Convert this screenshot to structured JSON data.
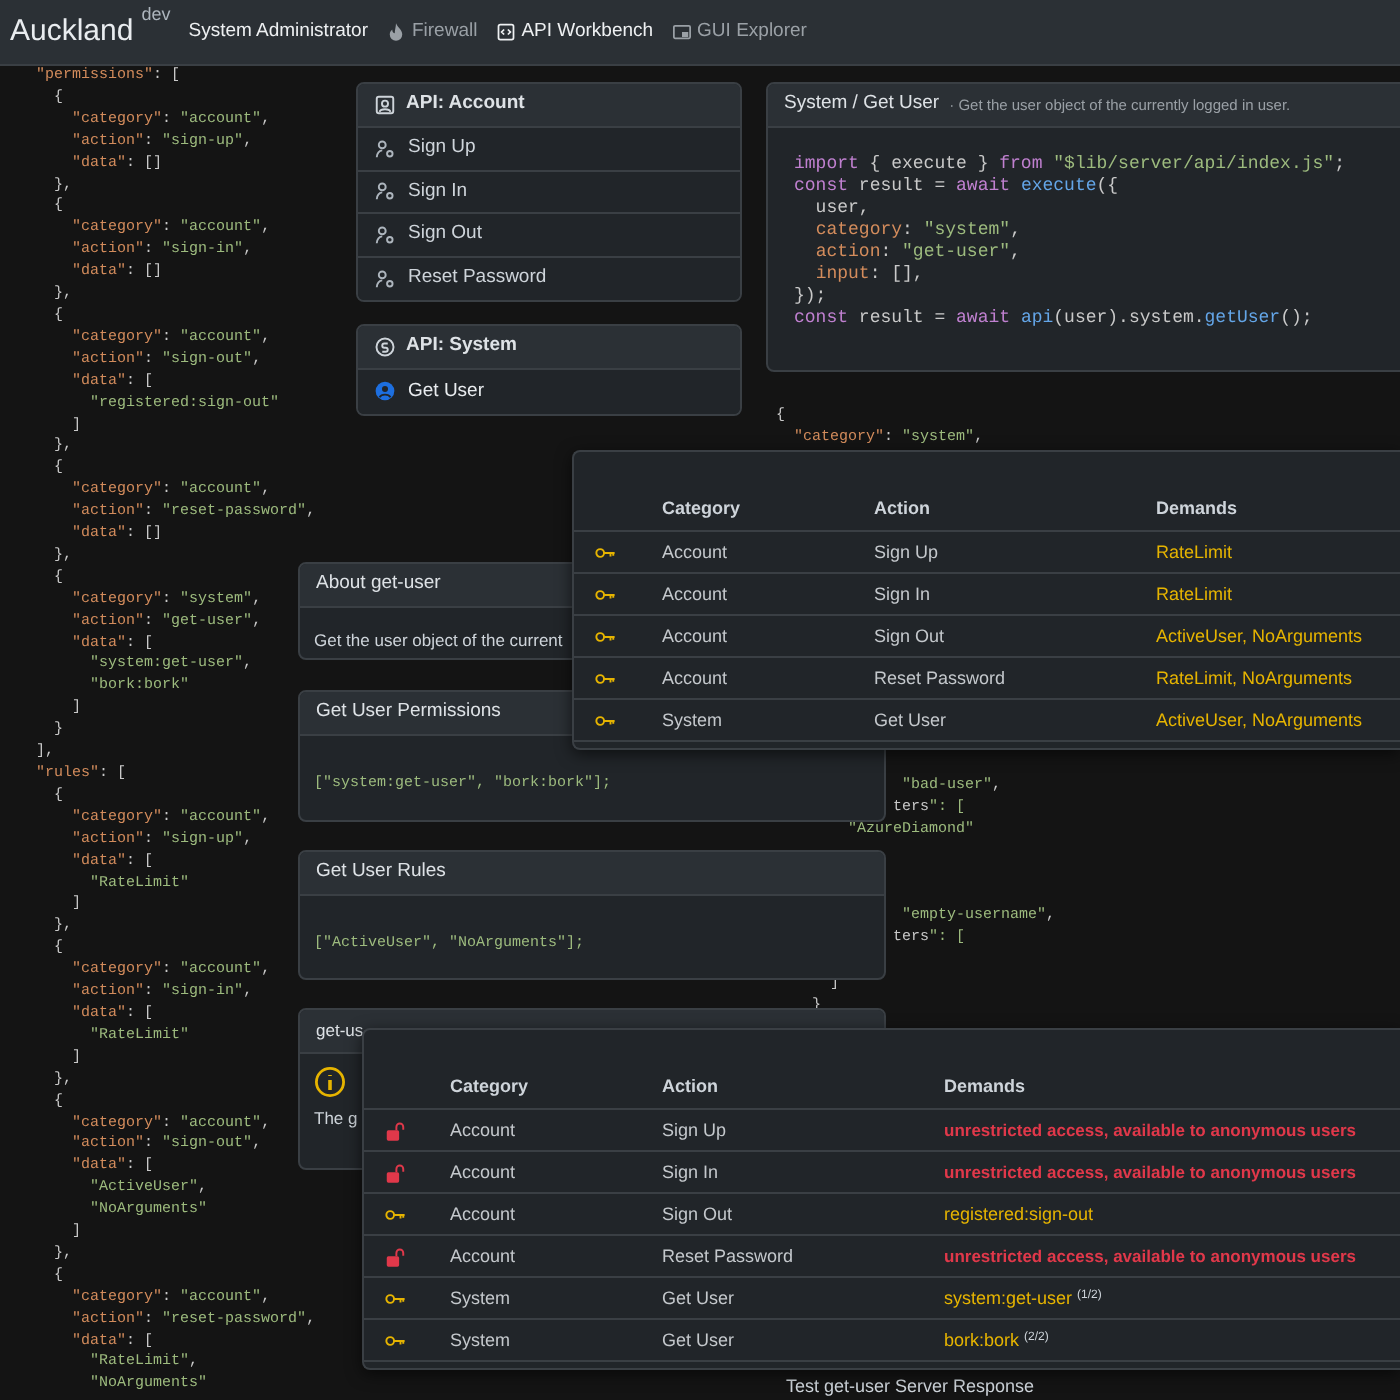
{
  "navbar": {
    "brand": "Auckland",
    "brand_tag": "dev",
    "user_role": "System Administrator",
    "items": [
      {
        "label": "Firewall",
        "kind": "fire",
        "selected": false
      },
      {
        "label": "API Workbench",
        "kind": "code",
        "selected": true
      },
      {
        "label": "GUI Explorer",
        "kind": "window",
        "selected": false
      }
    ]
  },
  "access_code": {
    "lines": [
      "  \"permissions\": [",
      "    {",
      "      \"category\": \"account\",",
      "      \"action\": \"sign-up\",",
      "      \"data\": []",
      "    },",
      "    {",
      "      \"category\": \"account\",",
      "      \"action\": \"sign-in\",",
      "      \"data\": []",
      "    },",
      "    {",
      "      \"category\": \"account\",",
      "      \"action\": \"sign-out\",",
      "      \"data\": [",
      "        \"registered:sign-out\"",
      "      ]",
      "    },",
      "    {",
      "      \"category\": \"account\",",
      "      \"action\": \"reset-password\",",
      "      \"data\": []",
      "    },",
      "    {",
      "      \"category\": \"system\",",
      "      \"action\": \"get-user\",",
      "      \"data\": [",
      "        \"system:get-user\",",
      "        \"bork:bork\"",
      "      ]",
      "    }",
      "  ],",
      "  \"rules\": [",
      "    {",
      "      \"category\": \"account\",",
      "      \"action\": \"sign-up\",",
      "      \"data\": [",
      "        \"RateLimit\"",
      "      ]",
      "    },",
      "    {",
      "      \"category\": \"account\",",
      "      \"action\": \"sign-in\",",
      "      \"data\": [",
      "        \"RateLimit\"",
      "      ]",
      "    },",
      "    {",
      "      \"category\": \"account\",",
      "      \"action\": \"sign-out\",",
      "      \"data\": [",
      "        \"ActiveUser\",",
      "        \"NoArguments\"",
      "      ]",
      "    },",
      "    {",
      "      \"category\": \"account\",",
      "      \"action\": \"reset-password\",",
      "      \"data\": [",
      "        \"RateLimit\",",
      "        \"NoArguments\""
    ]
  },
  "api_groups": [
    {
      "title": "API: Account",
      "kind": "account",
      "items": [
        {
          "label": "Sign Up",
          "selected": false
        },
        {
          "label": "Sign In",
          "selected": false
        },
        {
          "label": "Sign Out",
          "selected": false
        },
        {
          "label": "Reset Password",
          "selected": false
        }
      ]
    },
    {
      "title": "API: System",
      "kind": "system",
      "items": [
        {
          "label": "Get User",
          "selected": true
        }
      ]
    }
  ],
  "example": {
    "breadcrumb": "System / Get User",
    "description": "· Get the user object of the currently logged in user.",
    "code": [
      "import { execute } from \"$lib/server/api/index.js\";",
      "const result = await execute({",
      "  user,",
      "  category: \"system\",",
      "  action: \"get-user\",",
      "  input: [],",
      "});",
      "const result = await api(user).system.getUser();"
    ]
  },
  "response_code": [
    "{",
    "  \"category\": \"system\","
  ],
  "response_fragments": [
    [
      "              \"bad-user\",",
      "             ters\": [",
      "        \"AzureDiamond\""
    ],
    [
      "              \"empty-username\",",
      "             ters\": ["
    ],
    [
      "      ]",
      "    }"
    ]
  ],
  "about": {
    "title": "About get-user",
    "text": "Get the user object of the current"
  },
  "permissions_panel": {
    "title": "Get User Permissions",
    "code": "[\"system:get-user\", \"bork:bork\"];"
  },
  "rules_panel": {
    "title": "Get User Rules",
    "code": "[\"ActiveUser\", \"NoArguments\"];"
  },
  "tests_panel": {
    "title": "get-us",
    "text": "The g"
  },
  "rules_table": {
    "columns": [
      "Category",
      "Action",
      "Demands"
    ],
    "rows": [
      {
        "kind": "key",
        "category": "Account",
        "action": "Sign Up",
        "demands": "RateLimit"
      },
      {
        "kind": "key",
        "category": "Account",
        "action": "Sign In",
        "demands": "RateLimit"
      },
      {
        "kind": "key",
        "category": "Account",
        "action": "Sign Out",
        "demands": "ActiveUser, NoArguments"
      },
      {
        "kind": "key",
        "category": "Account",
        "action": "Reset Password",
        "demands": "RateLimit, NoArguments"
      },
      {
        "kind": "key",
        "category": "System",
        "action": "Get User",
        "demands": "ActiveUser, NoArguments"
      }
    ]
  },
  "permissions_table": {
    "columns": [
      "Category",
      "Action",
      "Demands"
    ],
    "rows": [
      {
        "kind": "open",
        "category": "Account",
        "action": "Sign Up",
        "demands": "unrestricted access, available to anonymous users"
      },
      {
        "kind": "open",
        "category": "Account",
        "action": "Sign In",
        "demands": "unrestricted access, available to anonymous users"
      },
      {
        "kind": "key",
        "category": "Account",
        "action": "Sign Out",
        "demands": "registered:sign-out"
      },
      {
        "kind": "open",
        "category": "Account",
        "action": "Reset Password",
        "demands": "unrestricted access, available to anonymous users"
      },
      {
        "kind": "key",
        "category": "System",
        "action": "Get User",
        "demands": "system:get-user $^{(1/2)}$"
      },
      {
        "kind": "key",
        "category": "System",
        "action": "Get User",
        "demands": "bork:bork $^{(2/2)}$"
      }
    ]
  },
  "server_response": {
    "title": "Test get-user Server Response"
  }
}
